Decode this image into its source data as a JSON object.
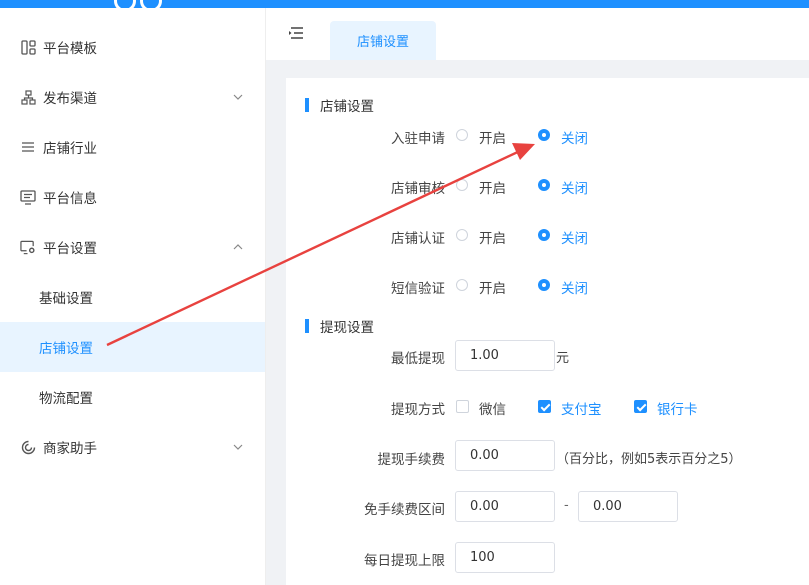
{
  "sidebar": {
    "items": [
      {
        "label": "平台模板",
        "icon": "template-grid-icon"
      },
      {
        "label": "发布渠道",
        "icon": "channel-tree-icon",
        "chevron": "chevron-down-icon"
      },
      {
        "label": "店铺行业",
        "icon": "list-icon"
      },
      {
        "label": "平台信息",
        "icon": "info-monitor-icon"
      },
      {
        "label": "平台设置",
        "icon": "settings-monitor-icon",
        "chevron": "chevron-up-icon"
      },
      {
        "label": "基础设置"
      },
      {
        "label": "店铺设置",
        "active": true
      },
      {
        "label": "物流配置"
      },
      {
        "label": "商家助手",
        "icon": "helper-icon",
        "chevron": "chevron-down-icon"
      }
    ]
  },
  "tabs": [
    {
      "label": "店铺设置",
      "active": true
    }
  ],
  "store_section": {
    "title": "店铺设置",
    "rows": [
      {
        "label": "入驻申请",
        "on": "开启",
        "off": "关闭",
        "selected": "off"
      },
      {
        "label": "店铺审核",
        "on": "开启",
        "off": "关闭",
        "selected": "off"
      },
      {
        "label": "店铺认证",
        "on": "开启",
        "off": "关闭",
        "selected": "off"
      },
      {
        "label": "短信验证",
        "on": "开启",
        "off": "关闭",
        "selected": "off"
      }
    ]
  },
  "withdraw_section": {
    "title": "提现设置",
    "min_withdraw": {
      "label": "最低提现",
      "value": "1.00",
      "unit": "元"
    },
    "methods": {
      "label": "提现方式",
      "options": [
        {
          "label": "微信",
          "checked": false
        },
        {
          "label": "支付宝",
          "checked": true
        },
        {
          "label": "银行卡",
          "checked": true
        }
      ]
    },
    "fee": {
      "label": "提现手续费",
      "value": "0.00",
      "note": "（百分比，例如5表示百分之5）"
    },
    "fee_free_range": {
      "label": "免手续费区间",
      "from": "0.00",
      "sep": "-",
      "to": "0.00"
    },
    "daily_limit": {
      "label": "每日提现上限",
      "value": "100"
    }
  },
  "colors": {
    "accent": "#1e90ff",
    "annotation_arrow": "#e8423f"
  }
}
